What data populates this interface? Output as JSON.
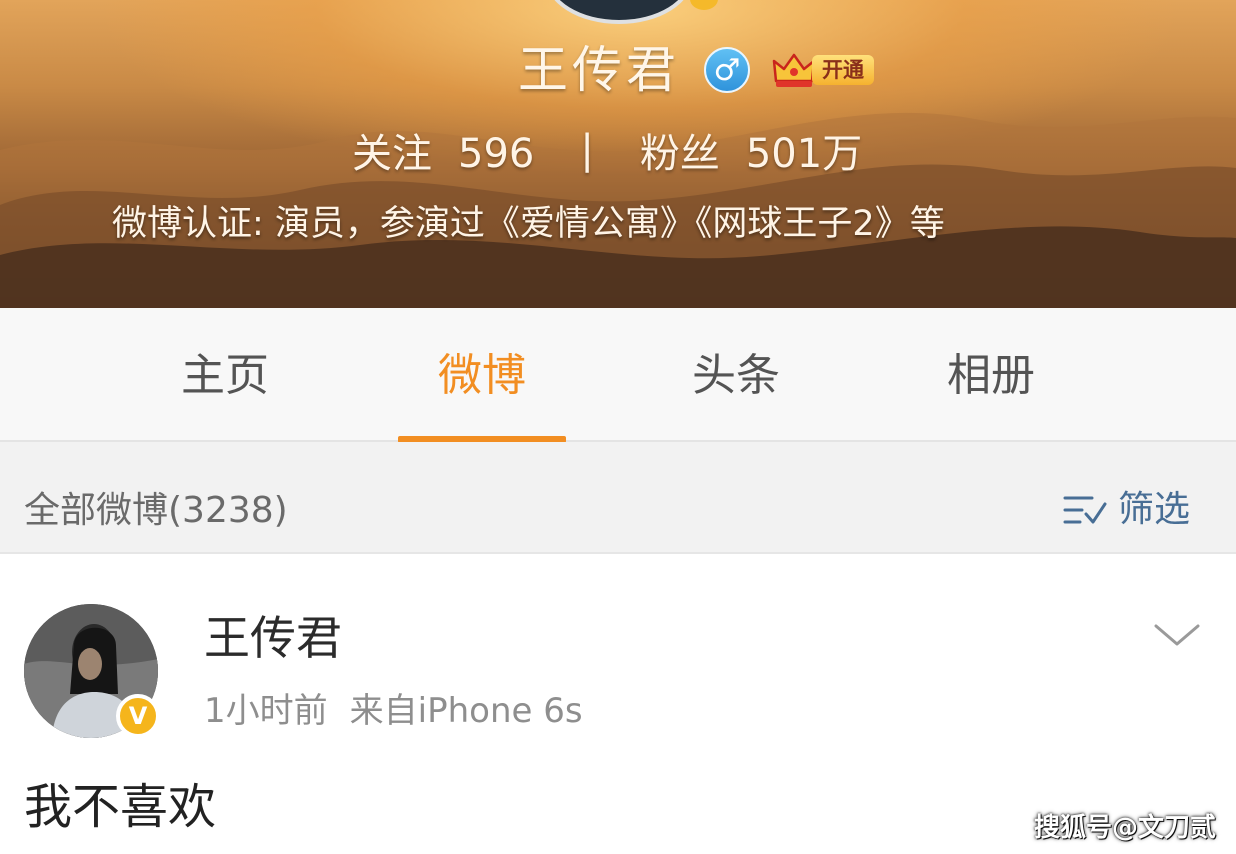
{
  "profile": {
    "name": "王传君",
    "gender_icon": "male-icon",
    "vip_badge": "开通",
    "stats": {
      "following_label": "关注",
      "following_count": "596",
      "separator": "|",
      "followers_label": "粉丝",
      "followers_count": "501万"
    },
    "verification": "微博认证: 演员，参演过《爱情公寓》《网球王子2》等"
  },
  "tabs": [
    {
      "label": "主页",
      "active": false
    },
    {
      "label": "微博",
      "active": true
    },
    {
      "label": "头条",
      "active": false
    },
    {
      "label": "相册",
      "active": false
    }
  ],
  "filter": {
    "all_posts_label": "全部微博(3238)",
    "filter_label": "筛选",
    "filter_icon": "filter-icon"
  },
  "post": {
    "author": "王传君",
    "time": "1小时前",
    "source": "来自iPhone 6s",
    "text": "我不喜欢",
    "verified_mark": "V",
    "menu_icon": "chevron-down-icon"
  },
  "watermark": "搜狐号@文刀贰",
  "colors": {
    "accent": "#f28e22",
    "filter_blue": "#486e95",
    "gender_blue": "#2f93db",
    "verified_gold": "#f5b51c",
    "vip_gold": "#f6b22f"
  }
}
